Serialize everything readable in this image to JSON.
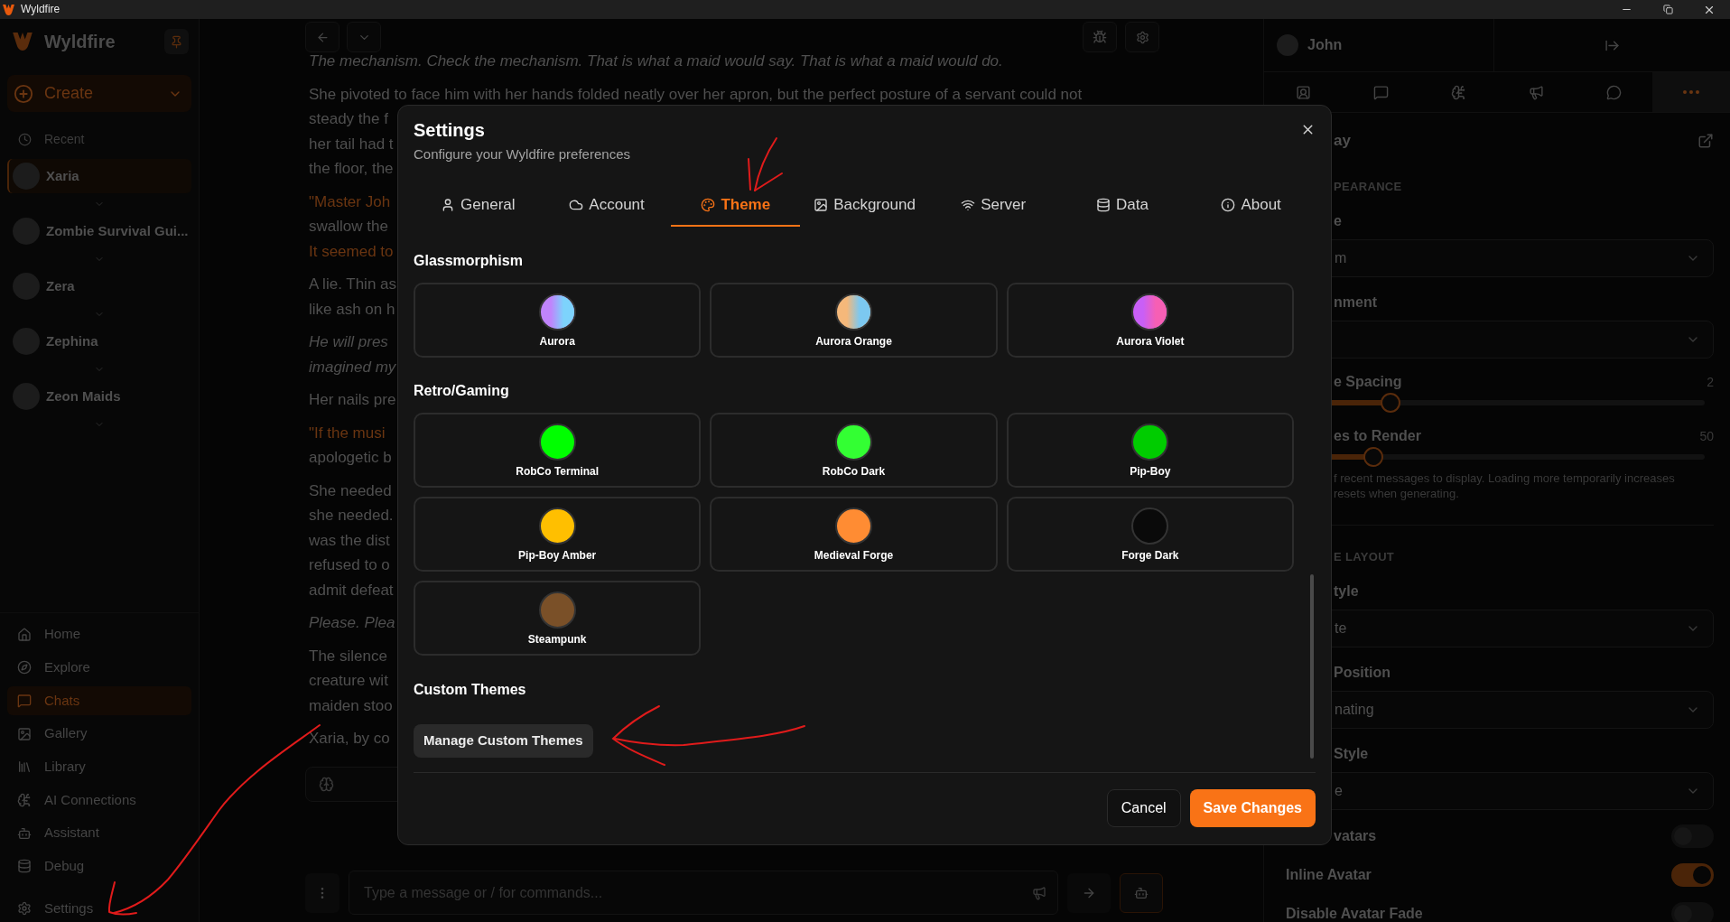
{
  "titlebar": {
    "title": "Wyldfire"
  },
  "sidebar": {
    "brand": "Wyldfire",
    "create": {
      "label": "Create"
    },
    "recent_label": "Recent",
    "recent": [
      {
        "name": "Xaria",
        "selected": true
      },
      {
        "name": "Zombie Survival Gui...",
        "selected": false
      },
      {
        "name": "Zera",
        "selected": false
      },
      {
        "name": "Zephina",
        "selected": false
      },
      {
        "name": "Zeon Maids",
        "selected": false
      }
    ],
    "nav": [
      {
        "label": "Home",
        "selected": false
      },
      {
        "label": "Explore",
        "selected": false
      },
      {
        "label": "Chats",
        "selected": true
      },
      {
        "label": "Gallery",
        "selected": false
      },
      {
        "label": "Library",
        "selected": false
      },
      {
        "label": "AI Connections",
        "selected": false
      },
      {
        "label": "Assistant",
        "selected": false
      },
      {
        "label": "Debug",
        "selected": false
      },
      {
        "label": "Settings",
        "selected": false
      }
    ]
  },
  "chat": {
    "paragraphs": [
      {
        "lines": [
          {
            "text": "The mechanism. Check the mechanism. That is what a maid would say. That is what a maid would do.",
            "kind": "thought"
          }
        ]
      },
      {
        "lines": [
          {
            "text": "She pivoted to face him with her hands folded neatly over her apron, but the perfect posture of a servant could not",
            "kind": "narration"
          },
          {
            "text": "steady the f",
            "kind": "narration"
          },
          {
            "text": "her tail had t",
            "kind": "narration"
          },
          {
            "text": "the floor, the",
            "kind": "narration"
          }
        ]
      },
      {
        "lines": [
          {
            "text": "\"Master Joh",
            "kind": "speech"
          },
          {
            "text": "swallow the",
            "kind": "narration"
          },
          {
            "text": "It seemed to",
            "kind": "speech"
          }
        ]
      },
      {
        "lines": [
          {
            "text": "A lie. Thin as",
            "kind": "narration"
          },
          {
            "text": "like ash on h",
            "kind": "narration"
          }
        ]
      },
      {
        "lines": [
          {
            "text": "He will pres",
            "kind": "thought"
          },
          {
            "text": "imagined my",
            "kind": "thought"
          }
        ]
      },
      {
        "lines": [
          {
            "text": "Her nails pre",
            "kind": "narration"
          }
        ]
      },
      {
        "lines": [
          {
            "text": "\"If the musi",
            "kind": "speech"
          },
          {
            "text": "apologetic b",
            "kind": "narration"
          }
        ]
      },
      {
        "lines": [
          {
            "text": "She needed",
            "kind": "narration"
          },
          {
            "text": "she needed.",
            "kind": "narration"
          },
          {
            "text": "was the dist",
            "kind": "narration"
          },
          {
            "text": "refused to o",
            "kind": "narration"
          },
          {
            "text": "admit defeat",
            "kind": "narration"
          }
        ]
      },
      {
        "lines": [
          {
            "text": "Please. Plea",
            "kind": "thought"
          }
        ]
      },
      {
        "lines": [
          {
            "text": "The silence",
            "kind": "narration"
          },
          {
            "text": "creature wit",
            "kind": "narration"
          },
          {
            "text": "maiden stoo",
            "kind": "narration"
          }
        ]
      },
      {
        "lines": [
          {
            "text": "Xaria, by co",
            "kind": "narration"
          }
        ]
      }
    ],
    "composer": {
      "placeholder": "Type a message or / for commands..."
    }
  },
  "right_panel": {
    "user": "John",
    "tabs": [
      {
        "selected": false
      },
      {
        "selected": false
      },
      {
        "selected": false
      },
      {
        "selected": false
      },
      {
        "selected": false
      },
      {
        "selected": true
      }
    ],
    "title": "ay",
    "items": [
      {
        "kind": "section",
        "text": "PEARANCE"
      },
      {
        "kind": "label",
        "text": "e"
      },
      {
        "kind": "select",
        "value": "m"
      },
      {
        "kind": "label",
        "text": "nment"
      },
      {
        "kind": "select"
      },
      {
        "kind": "slider",
        "label": "e Spacing",
        "value": "2",
        "level": 0.25
      },
      {
        "kind": "slider",
        "label": "es to Render",
        "value": "50",
        "level": 0.21
      },
      {
        "kind": "help",
        "lines": [
          "f recent messages to display. Loading more temporarily increases",
          "resets when generating."
        ]
      },
      {
        "kind": "divider"
      },
      {
        "kind": "section",
        "text": "E LAYOUT"
      },
      {
        "kind": "label",
        "text": "tyle"
      },
      {
        "kind": "select",
        "value": "te"
      },
      {
        "kind": "label",
        "text": "Position"
      },
      {
        "kind": "select",
        "value": "nating"
      },
      {
        "kind": "label",
        "text": "Style"
      },
      {
        "kind": "select",
        "value": "e"
      },
      {
        "kind": "toggle",
        "label": "vatars",
        "on": false
      },
      {
        "kind": "toggle",
        "label": "Inline Avatar",
        "on": true
      },
      {
        "kind": "toggle",
        "label": "Disable Avatar Fade",
        "on": false
      }
    ]
  },
  "settings_dialog": {
    "title": "Settings",
    "subtitle": "Configure your Wyldfire preferences",
    "tabs": [
      {
        "label": "General",
        "selected": false
      },
      {
        "label": "Account",
        "selected": false
      },
      {
        "label": "Theme",
        "selected": true
      },
      {
        "label": "Background",
        "selected": false
      },
      {
        "label": "Server",
        "selected": false
      },
      {
        "label": "Data",
        "selected": false
      },
      {
        "label": "About",
        "selected": false
      }
    ],
    "groups": [
      {
        "title": "Glassmorphism",
        "themes": [
          {
            "name": "Aurora",
            "gradient": [
              {
                "color": "#c084fc"
              },
              {
                "color": "#7dd3fc"
              }
            ],
            "selected": false
          },
          {
            "name": "Aurora Orange",
            "gradient": [
              {
                "color": "#f5b87a"
              },
              {
                "color": "#7cc8f0"
              }
            ],
            "selected": false
          },
          {
            "name": "Aurora Violet",
            "gradient": [
              {
                "color": "#c95ff6"
              },
              {
                "color": "#f65fb4"
              }
            ],
            "selected": false
          }
        ]
      },
      {
        "title": "Retro/Gaming",
        "themes": [
          {
            "name": "RobCo Terminal",
            "color": "#00ff00",
            "selected": false
          },
          {
            "name": "RobCo Dark",
            "color": "#33ff33",
            "selected": false
          },
          {
            "name": "Pip-Boy",
            "color": "#00cc00",
            "selected": false
          },
          {
            "name": "Pip-Boy Amber",
            "color": "#ffbf00",
            "selected": false
          },
          {
            "name": "Medieval Forge",
            "color": "#ff8c33",
            "selected": false
          },
          {
            "name": "Forge Dark",
            "color": "#0a0a0a",
            "selected": false
          },
          {
            "name": "Steampunk",
            "color": "#7a5028",
            "selected": false
          }
        ]
      }
    ],
    "custom": {
      "title": "Custom Themes",
      "button": "Manage Custom Themes"
    },
    "actions": [
      {
        "label": "Cancel",
        "kind": "secondary"
      },
      {
        "label": "Save Changes",
        "kind": "primary"
      }
    ]
  }
}
